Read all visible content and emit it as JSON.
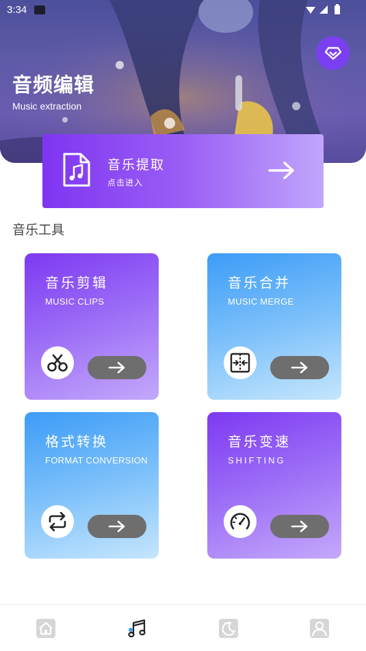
{
  "status_bar": {
    "time": "3:34"
  },
  "header": {
    "title": "音频编辑",
    "subtitle": "Music extraction",
    "vip_icon": "diamond-icon"
  },
  "extract_card": {
    "title": "音乐提取",
    "subtitle": "点击进入",
    "icon": "music-file-icon"
  },
  "section": {
    "title": "音乐工具"
  },
  "tools": [
    {
      "title": "音乐剪辑",
      "subtitle": "MUSIC CLIPS",
      "icon": "scissors-icon",
      "color": "purple"
    },
    {
      "title": "音乐合并",
      "subtitle": "MUSIC MERGE",
      "icon": "merge-icon",
      "color": "blue"
    },
    {
      "title": "格式转换",
      "subtitle": "FORMAT CONVERSION",
      "icon": "repeat-icon",
      "color": "blue"
    },
    {
      "title": "音乐变速",
      "subtitle": "SHIFTING",
      "icon": "speedometer-icon",
      "color": "purple"
    }
  ],
  "bottom_nav": [
    {
      "icon": "home-icon",
      "active": false
    },
    {
      "icon": "music-note-icon",
      "active": true
    },
    {
      "icon": "moon-icon",
      "active": false
    },
    {
      "icon": "user-icon",
      "active": false
    }
  ],
  "colors": {
    "accent_purple": "#7d39f2",
    "accent_blue": "#3d9cf7",
    "arrow_pill": "#6e6e6e"
  }
}
